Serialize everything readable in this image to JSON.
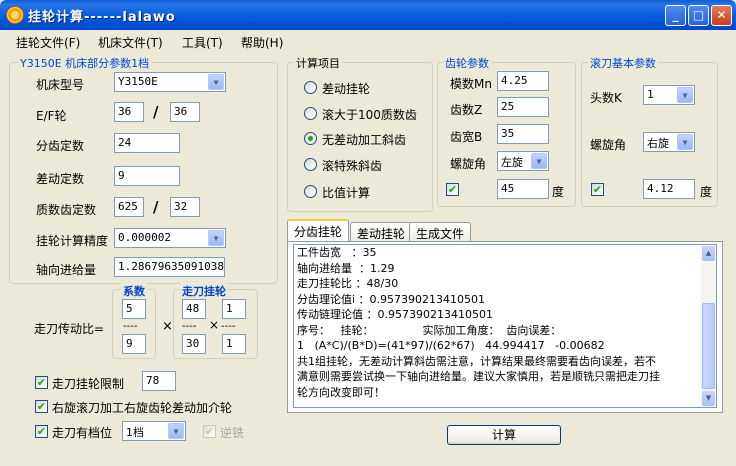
{
  "window": {
    "title": "挂轮计算------lalawo",
    "min": "_",
    "max": "□",
    "close": "✕"
  },
  "menu": [
    {
      "label": "挂轮文件(F)"
    },
    {
      "label": "机床文件(T)"
    },
    {
      "label": "工具(T)"
    },
    {
      "label": "帮助(H)"
    }
  ],
  "machine_group": {
    "title": "Y3150E 机床部分参数1档",
    "model_label": "机床型号",
    "model_value": "Y3150E",
    "ef_label": "E/F轮",
    "e_value": "36",
    "f_value": "36",
    "slash": "/",
    "fenchi_label": "分齿定数",
    "fenchi_value": "24",
    "chadong_label": "差动定数",
    "chadong_value": "9",
    "zhishu_label": "质数齿定数",
    "zhishu_a": "625",
    "zhishu_b": "32",
    "precision_label": "挂轮计算精度",
    "precision_value": "0.000002",
    "feed_label": "轴向进给量",
    "feed_value": "1.28679635091038",
    "ratio_label": "走刀传动比=",
    "coef_title": "系数",
    "coef_top": "5",
    "coef_bottom": "9",
    "dashes": "----",
    "feed_gear_title": "走刀挂轮",
    "fg_a": "48",
    "fg_b": "1",
    "fg_c": "30",
    "fg_d": "1",
    "times": "×"
  },
  "options": {
    "limit_label": "走刀挂轮限制",
    "limit_checked": true,
    "limit_value": "78",
    "right_hand_label": "右旋滚刀加工右旋齿轮差动加介轮",
    "right_hand_checked": true,
    "gear_pos_label": "走刀有档位",
    "gear_pos_checked": true,
    "gear_pos_value": "1档",
    "reverse_label": "逆铣",
    "reverse_checked": true
  },
  "calc_group": {
    "title": "计算项目",
    "items": [
      {
        "label": "差动挂轮",
        "selected": false
      },
      {
        "label": "滚大于100质数齿",
        "selected": false
      },
      {
        "label": "无差动加工斜齿",
        "selected": true
      },
      {
        "label": "滚特殊斜齿",
        "selected": false
      },
      {
        "label": "比值计算",
        "selected": false
      }
    ]
  },
  "gear_group": {
    "title": "齿轮参数",
    "module_label": "模数Mn",
    "module_value": "4.25",
    "teeth_label": "齿数Z",
    "teeth_value": "25",
    "width_label": "齿宽B",
    "width_value": "35",
    "helix_label": "螺旋角",
    "helix_value": "左旋",
    "angle_value": "45",
    "degree": "度"
  },
  "hob_group": {
    "title": "滚刀基本参数",
    "starts_label": "头数K",
    "starts_value": "1",
    "helix_label": "螺旋角",
    "helix_value": "右旋",
    "angle_value": "4.12",
    "degree": "度"
  },
  "tabs": [
    {
      "label": "分齿挂轮",
      "active": true
    },
    {
      "label": "差动挂轮",
      "active": false
    },
    {
      "label": "生成文件",
      "active": false
    }
  ],
  "output_lines": [
    "工件齿宽   ：35",
    "轴向进给量  ：1.29",
    "走刀挂轮比 ：48/30",
    "分齿理论值i ：0.957390213410501",
    "传动链理论值 ：0.957390213410501",
    "序号：   挂轮：              实际加工角度：  齿向误差：",
    "1   (A*C)/(B*D)=(41*97)/(62*67)   44.994417   -0.00682",
    "共1组挂轮，无差动计算斜齿需注意，计算结果最终需要看齿向误差，若不",
    "满意则需要尝试换一下轴向进给量。建议大家慎用，若是顺铣只需把走刀挂",
    "轮方向改变即可！"
  ],
  "calc_button": "计算"
}
